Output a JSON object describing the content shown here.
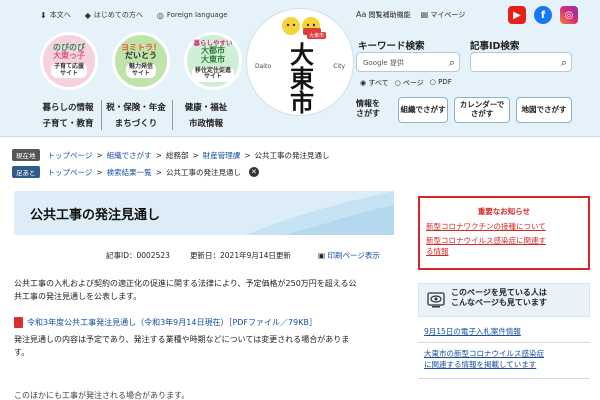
{
  "header": {
    "top_links": [
      "本文へ",
      "はじめての方へ",
      "Foreign language"
    ],
    "right_links": [
      "閲覧補助機能",
      "マイページ"
    ],
    "circles": [
      {
        "lines": [
          "のびのび",
          "大東っ子"
        ],
        "tag_lines": [
          "子育て応援",
          "サイト"
        ]
      },
      {
        "lines": [
          "ヨミトラ！",
          "だいとう"
        ],
        "tag_lines": [
          "魅力発信",
          "サイト"
        ]
      },
      {
        "lines": [
          "暮らしやすい",
          "大都市",
          "大東市"
        ],
        "tag_lines": [
          "移住定住促進",
          "サイト"
        ]
      }
    ],
    "nav_col1": [
      "暮らしの情報",
      "子育て・教育"
    ],
    "nav_col2": [
      "税・保険・年金",
      "まちづくり"
    ],
    "nav_col3": [
      "健康・福祉",
      "市政情報"
    ],
    "logo": {
      "kanji": "大東市",
      "left": "Daito",
      "right": "City",
      "badge": "大東市"
    },
    "keyword_search": {
      "label": "キーワード検索",
      "google": "Google 提供",
      "button_icon": "search-icon"
    },
    "id_search": {
      "label": "記事ID検索",
      "button_icon": "search-icon"
    },
    "radios": [
      "すべて",
      "ページ",
      "PDF"
    ],
    "find_label": [
      "情報を",
      "さがす"
    ],
    "find_buttons": [
      [
        "組織でさがす"
      ],
      [
        "カレンダーで",
        "さがす"
      ],
      [
        "地図でさがす"
      ]
    ],
    "sns": [
      {
        "name": "youtube-icon",
        "color": "#e62117"
      },
      {
        "name": "facebook-icon",
        "color": "#1877f2"
      },
      {
        "name": "instagram-icon",
        "color": "#c13584"
      }
    ]
  },
  "breadcrumbs": {
    "current": {
      "tag": "現在地",
      "items": [
        "トップページ",
        "組織でさがす",
        "総務部",
        "財産管理課",
        "公共工事の発注見通し"
      ]
    },
    "trail": {
      "tag": "足あと",
      "items": [
        "トップページ",
        "検索結果一覧",
        "公共工事の発注見通し"
      ]
    }
  },
  "article": {
    "title": "公共工事の発注見通し",
    "article_id": "記事ID：0002523",
    "updated": "更新日：2021年9月14日更新",
    "print": "印刷ページ表示",
    "para1_lines": [
      "公共工事の入札および契約の適正化の促進に関する法律により、予定価格が250万円を超える公",
      "共工事の発注見通しを公表します。"
    ],
    "pdf_link": "令和3年度公共工事発注見通し（令和3年9月14日現在）［PDFファイル／79KB］",
    "para2_lines": [
      "発注見通しの内容は予定であり、発注する業種や時期などについては変更される場合がありま",
      "す。"
    ],
    "para3_partial": "このほかにも工事が発注される場合があります。"
  },
  "notice": {
    "heading": "重要なお知らせ",
    "link1": "新型コロナワクチンの接種について",
    "link2_lines": [
      "新型コロナウイルス感染症に関連す",
      "る情報"
    ]
  },
  "sidebar": {
    "box_lines": [
      "このページを見ている人は",
      "こんなページも見ています"
    ],
    "link1": "9月15日の電子入札案件情報",
    "link2_lines": [
      "大東市の新型コロナウイルス感染症",
      "に関連する情報を掲載しています"
    ]
  }
}
